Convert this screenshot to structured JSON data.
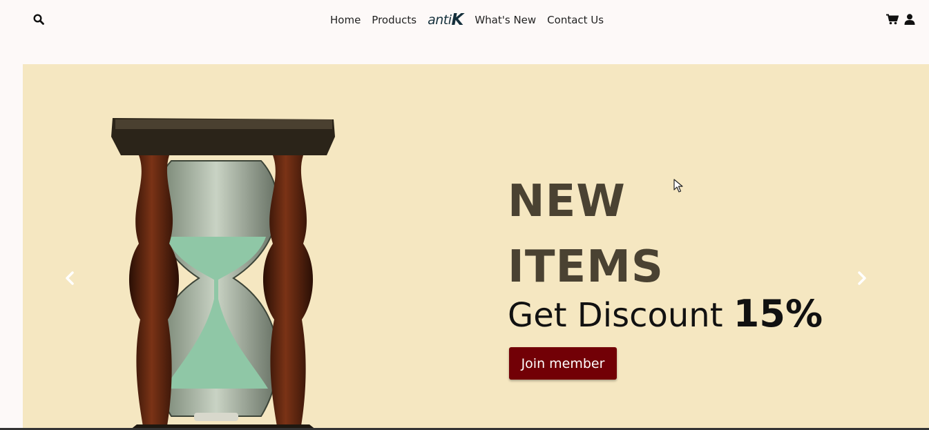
{
  "nav": {
    "links": [
      "Home",
      "Products"
    ],
    "links_right": [
      "What's New",
      "Contact Us"
    ],
    "brand_part1": "anti",
    "brand_part2": "K"
  },
  "hero": {
    "title_line1": "NEW",
    "title_line2": "ITEMS",
    "discount_prefix": "Get Discount",
    "discount_value": "15%",
    "cta_label": "Join member"
  },
  "icons": {
    "search": "search-icon",
    "cart": "cart-icon",
    "user": "user-icon",
    "prev": "chevron-left-icon",
    "next": "chevron-right-icon"
  },
  "colors": {
    "page_background": "#fdf9f8",
    "hero_background": "#f5e7c1",
    "title_color": "#4a4232",
    "cta_background": "#720006",
    "brand_color": "#15303c"
  }
}
